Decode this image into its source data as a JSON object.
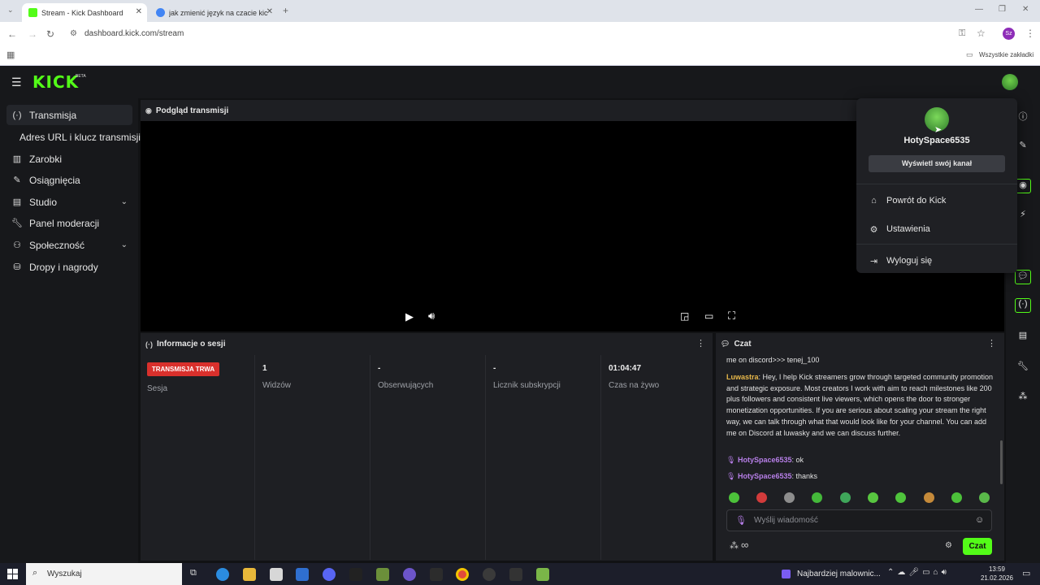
{
  "browser": {
    "tabs": [
      {
        "title": "Stream - Kick Dashboard",
        "active": true
      },
      {
        "title": "jak zmienić język na czacie kick",
        "active": false
      }
    ],
    "new_tab": "+",
    "url": "dashboard.kick.com/stream",
    "bookmarks_all": "Wszystkie zakładki",
    "profile_initials": "Sz"
  },
  "header": {
    "logo": "KICK",
    "logo_badge": "BETA"
  },
  "sidebar": {
    "items": [
      {
        "label": "Transmisja",
        "icon": "broadcast-icon"
      },
      {
        "label": "Adres URL i klucz transmisji",
        "icon": ""
      },
      {
        "label": "Zarobki",
        "icon": "earnings-icon"
      },
      {
        "label": "Osiągnięcia",
        "icon": "achievements-icon"
      },
      {
        "label": "Studio",
        "icon": "studio-icon"
      },
      {
        "label": "Panel moderacji",
        "icon": "wrench-icon"
      },
      {
        "label": "Społeczność",
        "icon": "community-icon"
      },
      {
        "label": "Dropy i nagrody",
        "icon": "drops-icon"
      }
    ]
  },
  "preview": {
    "title": "Podgląd transmisji"
  },
  "session": {
    "title": "Informacje o sesji",
    "badge": "TRANSMISJA TRWA",
    "badge_color": "#d9302c",
    "session_label": "Sesja",
    "stats": [
      {
        "value": "1",
        "label": "Widzów"
      },
      {
        "value": "-",
        "label": "Obserwujących"
      },
      {
        "value": "-",
        "label": "Licznik subskrypcji"
      },
      {
        "value": "01:04:47",
        "label": "Czas na żywo"
      }
    ]
  },
  "chat": {
    "title": "Czat",
    "top_line": "me on discord>>> tenej_100",
    "messages": [
      {
        "user": "Luwastra",
        "text": ": Hey, I help Kick streamers grow through targeted community promotion and strategic exposure. Most creators I work with aim to reach milestones like 200 plus followers and consistent live viewers, which opens the door to stronger monetization opportunities. If you are serious about scaling your stream the right way, we can talk through what that would look like for your channel. You can add me on Discord at luwasky and we can discuss further."
      },
      {
        "user": "HotySpace6535",
        "text": ": ok"
      },
      {
        "user": "HotySpace6535",
        "text": ": thanks"
      }
    ],
    "input_placeholder": "Wyślij wiadomość",
    "infinity": "∞",
    "send_label": "Czat"
  },
  "dropdown": {
    "username": "HotySpace6535",
    "view_channel": "Wyświetl swój kanał",
    "items": [
      {
        "label": "Powrót do Kick",
        "icon": "home-icon"
      },
      {
        "label": "Ustawienia",
        "icon": "gear-icon"
      },
      {
        "label": "Wyloguj się",
        "icon": "logout-icon"
      }
    ]
  },
  "taskbar": {
    "search_placeholder": "Wyszukaj",
    "notification": "Najbardziej malownic...",
    "time": "13:59",
    "date": "21.02.2026"
  },
  "colors": {
    "kick_green": "#53fc18",
    "send_green": "#53fc18"
  }
}
